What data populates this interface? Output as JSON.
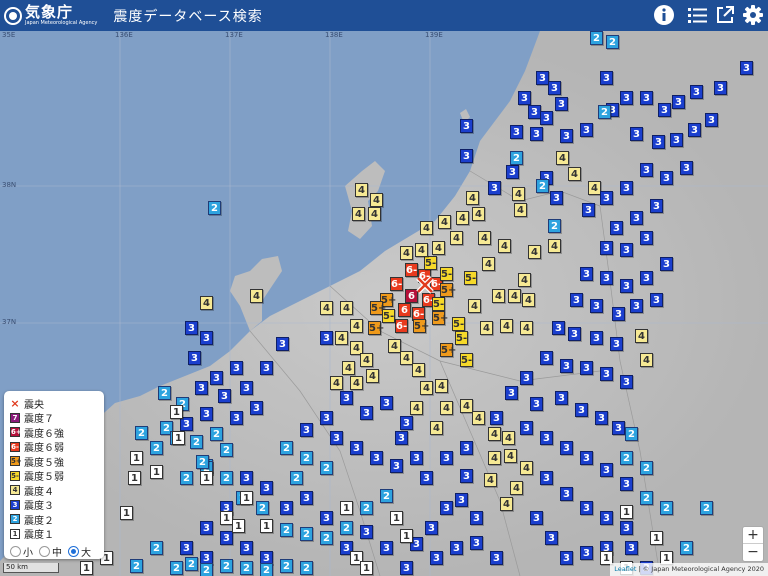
{
  "header": {
    "logo_text": "気象庁",
    "logo_sub": "Japan Meteorological Agency",
    "title": "震度データベース検索",
    "info_icon": "info-icon",
    "list_icon": "list-icon",
    "external_icon": "external-link-icon",
    "settings_icon": "gear-icon"
  },
  "map": {
    "graticule_labels": [
      "35E",
      "136E",
      "137E",
      "138E",
      "139E",
      "38N",
      "37N"
    ],
    "epicenter_label": "震央",
    "scale_label": "50 km"
  },
  "legend": {
    "items": [
      {
        "label": "震央",
        "sym": "×",
        "cls": "x"
      },
      {
        "label": "震度７",
        "sym": "7",
        "cls": "i7"
      },
      {
        "label": "震度６強",
        "sym": "6+",
        "cls": "i6p"
      },
      {
        "label": "震度６弱",
        "sym": "6-",
        "cls": "i6m"
      },
      {
        "label": "震度５強",
        "sym": "5+",
        "cls": "i5p"
      },
      {
        "label": "震度５弱",
        "sym": "5-",
        "cls": "i5m"
      },
      {
        "label": "震度４",
        "sym": "4",
        "cls": "i4"
      },
      {
        "label": "震度３",
        "sym": "3",
        "cls": "i3"
      },
      {
        "label": "震度２",
        "sym": "2",
        "cls": "i2"
      },
      {
        "label": "震度１",
        "sym": "1",
        "cls": "i1"
      }
    ],
    "size_options": [
      "小",
      "中",
      "大"
    ],
    "size_selected": "大"
  },
  "zoom": {
    "in": "+",
    "out": "−"
  },
  "attribution": {
    "leaflet": "Leaflet",
    "text": " | © Japan Meteorological Agency 2020"
  }
}
